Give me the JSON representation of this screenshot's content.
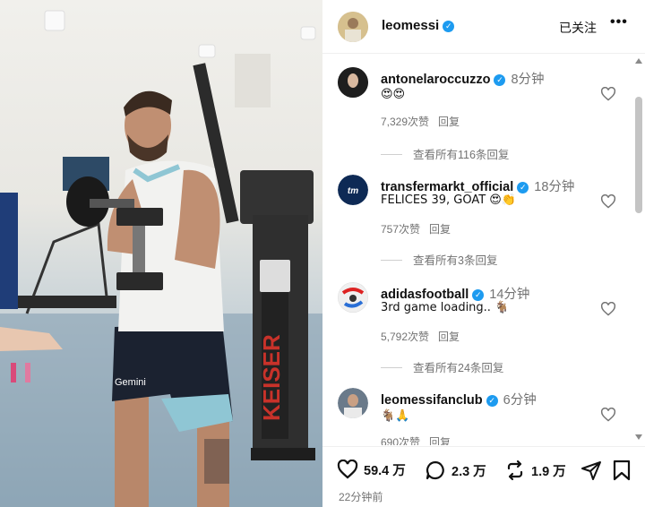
{
  "post": {
    "username": "leomessi",
    "follow_label": "已关注",
    "more_label": "•••",
    "photo_texts": {
      "shirt_brand": "Gemini",
      "machine_brand": "KEISER"
    }
  },
  "comments": [
    {
      "username": "antonelaroccuzzo",
      "time": "8分钟",
      "text": "😍😍",
      "likes": "7,329次赞",
      "reply": "回复",
      "view_replies": "查看所有116条回复"
    },
    {
      "username": "transfermarkt_official",
      "time": "18分钟",
      "text": "FELICES 39, GOAT 😍👏",
      "likes": "757次赞",
      "reply": "回复",
      "view_replies": "查看所有3条回复"
    },
    {
      "username": "adidasfootball",
      "time": "14分钟",
      "text": "3rd game loading.. 🐐",
      "likes": "5,792次赞",
      "reply": "回复",
      "view_replies": "查看所有24条回复"
    },
    {
      "username": "leomessifanclub",
      "time": "6分钟",
      "text": "🐐🙏",
      "likes": "690次赞",
      "reply": "回复"
    }
  ],
  "stats": {
    "likes": "59.4 万",
    "comments": "2.3 万",
    "reposts": "1.9 万"
  },
  "posted_time": "22分钟前",
  "colors": {
    "verified": "#1d9bf0",
    "muted_text": "#737373"
  }
}
